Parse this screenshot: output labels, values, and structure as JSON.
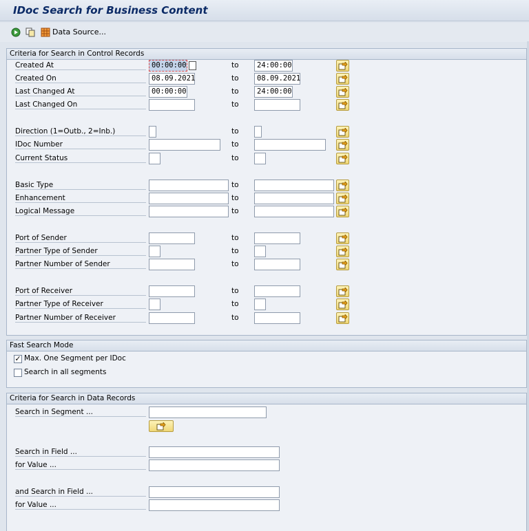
{
  "window": {
    "title": "IDoc Search for Business Content"
  },
  "toolbar": {
    "data_source_label": "Data Source..."
  },
  "control_records": {
    "header": "Criteria for Search in Control Records",
    "to_label": "to",
    "rows": [
      {
        "label": "Created At",
        "from": "00:00:00",
        "to": "24:00:00"
      },
      {
        "label": "Created On",
        "from": "08.09.2021",
        "to": "08.09.2021"
      },
      {
        "label": "Last Changed At",
        "from": "00:00:00",
        "to": "24:00:00"
      },
      {
        "label": "Last Changed On",
        "from": "",
        "to": ""
      },
      {
        "label": "Direction (1=Outb., 2=Inb.)",
        "from": "",
        "to": ""
      },
      {
        "label": "IDoc Number",
        "from": "",
        "to": ""
      },
      {
        "label": "Current Status",
        "from": "",
        "to": ""
      },
      {
        "label": "Basic Type",
        "from": "",
        "to": ""
      },
      {
        "label": "Enhancement",
        "from": "",
        "to": ""
      },
      {
        "label": "Logical Message",
        "from": "",
        "to": ""
      },
      {
        "label": "Port of Sender",
        "from": "",
        "to": ""
      },
      {
        "label": "Partner Type of Sender",
        "from": "",
        "to": ""
      },
      {
        "label": "Partner Number of Sender",
        "from": "",
        "to": ""
      },
      {
        "label": "Port of Receiver",
        "from": "",
        "to": ""
      },
      {
        "label": "Partner Type of Receiver",
        "from": "",
        "to": ""
      },
      {
        "label": "Partner Number of Receiver",
        "from": "",
        "to": ""
      }
    ]
  },
  "fast_search": {
    "header": "Fast Search Mode",
    "max_one_segment": {
      "label": "Max. One Segment per IDoc",
      "checked": true
    },
    "search_all_segments": {
      "label": "Search in all segments",
      "checked": false
    }
  },
  "data_records": {
    "header": "Criteria for Search in Data Records",
    "segment_label": "Search in Segment ...",
    "segment_value": "",
    "field1_label": "Search in Field ...",
    "field1_value": "",
    "value1_label": "for Value ...",
    "value1_value": "",
    "field2_label": "and Search in Field ...",
    "field2_value": "",
    "value2_label": "for Value ...",
    "value2_value": ""
  },
  "icons": {
    "execute": "execute-icon",
    "copy": "copy-icon",
    "table": "table-icon",
    "multiple_selection": "multiple-selection-icon"
  },
  "colors": {
    "title": "#0b2a66",
    "focus_field": "#c4d4ea",
    "select_button": "#f0d777"
  }
}
